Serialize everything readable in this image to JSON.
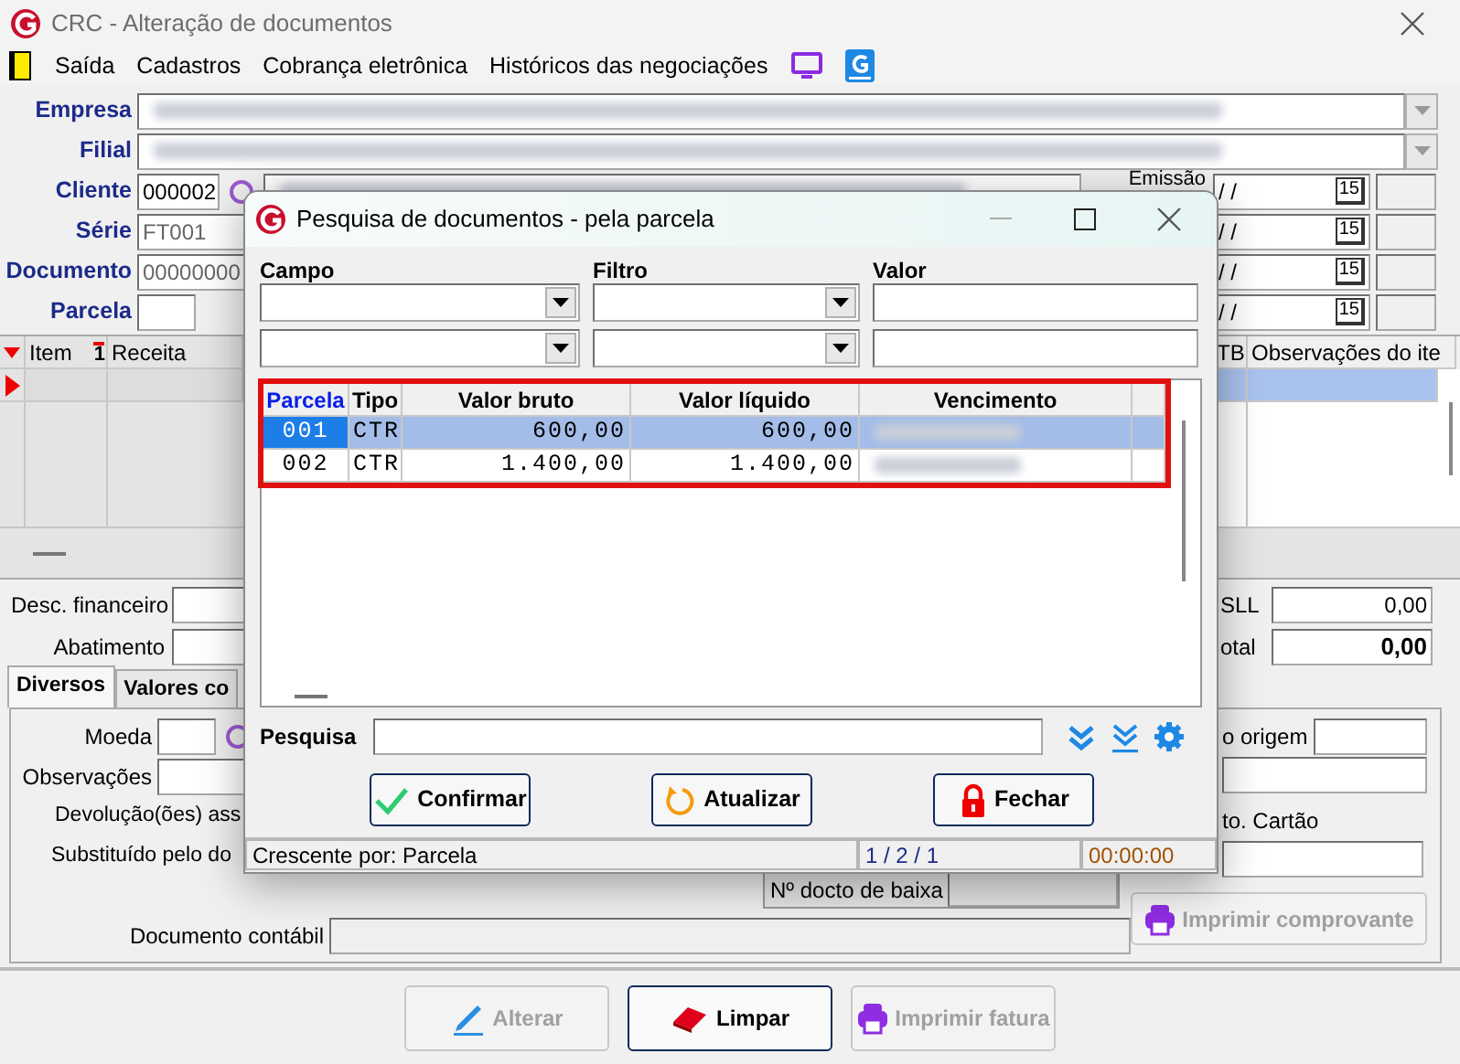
{
  "window": {
    "title": "CRC - Alteração de documentos"
  },
  "menu": [
    {
      "label": "Saída"
    },
    {
      "label": "Cadastros"
    },
    {
      "label": "Cobrança eletrônica"
    },
    {
      "label": "Históricos das negociações"
    }
  ],
  "header_fields": [
    {
      "label": "Empresa",
      "kind": "combo",
      "blurred": true
    },
    {
      "label": "Filial",
      "kind": "combo",
      "blurred": true
    },
    {
      "label": "Cliente",
      "kind": "lookup",
      "value": "000002",
      "blurred": true
    },
    {
      "label": "Série",
      "kind": "text",
      "value": "FT001"
    },
    {
      "label": "Documento",
      "kind": "text",
      "value": "00000000"
    },
    {
      "label": "Parcela",
      "kind": "short"
    }
  ],
  "date_fields": [
    {
      "label": "Emissão",
      "value": "/ /",
      "button": "15"
    },
    {
      "value": "/ /",
      "button": "15"
    },
    {
      "value": "/ /",
      "button": "15"
    },
    {
      "value": "/ /",
      "button": "15"
    }
  ],
  "items_grid": {
    "columns": [
      "Item",
      "Receita",
      "TB",
      "Observações do ite"
    ],
    "sort_mark": "1"
  },
  "totals_left": [
    {
      "label": "Desc. financeiro"
    },
    {
      "label": "Abatimento"
    }
  ],
  "totals_right": [
    {
      "label": "SLL",
      "value": "0,00",
      "bold": false
    },
    {
      "label": "otal",
      "value": "0,00",
      "bold": true
    }
  ],
  "tabs": [
    {
      "label": "Diversos",
      "selected": true
    },
    {
      "label": "Valores co",
      "selected": false
    }
  ],
  "diversos": {
    "moeda": "Moeda",
    "observacoes": "Observações",
    "devolucoes": "Devolução(ões) ass",
    "substituido": "Substituído pelo do",
    "docto_baixa": "Nº docto de baixa",
    "documento_contabil": "Documento contábil",
    "origem": "o origem",
    "cartao": "to. Cartão",
    "print_button": {
      "label": "Imprimir comprovante",
      "disabled": true
    }
  },
  "bottom_buttons": [
    {
      "label": "Alterar",
      "kind": "pencil",
      "disabled": true
    },
    {
      "label": "Limpar",
      "kind": "eraser",
      "disabled": false
    },
    {
      "label": "Imprimir fatura",
      "kind": "printer",
      "disabled": true
    }
  ],
  "dialog": {
    "title": "Pesquisa de documentos - pela parcela",
    "filter_headers": [
      "Campo",
      "Filtro",
      "Valor"
    ],
    "columns": [
      {
        "label": "Parcela",
        "sorted": true
      },
      {
        "label": "Tipo",
        "sorted": false
      },
      {
        "label": "Valor bruto",
        "sorted": false
      },
      {
        "label": "Valor líquido",
        "sorted": false
      },
      {
        "label": "Vencimento",
        "sorted": false
      }
    ],
    "rows": [
      {
        "parcela": "001",
        "tipo": "CTR",
        "valor_bruto": "600,00",
        "valor_liquido": "600,00",
        "vencimento_blurred": true,
        "selected": true
      },
      {
        "parcela": "002",
        "tipo": "CTR",
        "valor_bruto": "1.400,00",
        "valor_liquido": "1.400,00",
        "vencimento_blurred": true,
        "selected": false
      }
    ],
    "search_label": "Pesquisa",
    "buttons": [
      {
        "label": "Confirmar",
        "kind": "check"
      },
      {
        "label": "Atualizar",
        "kind": "refresh"
      },
      {
        "label": "Fechar",
        "kind": "lock"
      }
    ],
    "status": [
      "Crescente por: Parcela",
      "1 / 2 / 1",
      "00:00:00"
    ]
  }
}
